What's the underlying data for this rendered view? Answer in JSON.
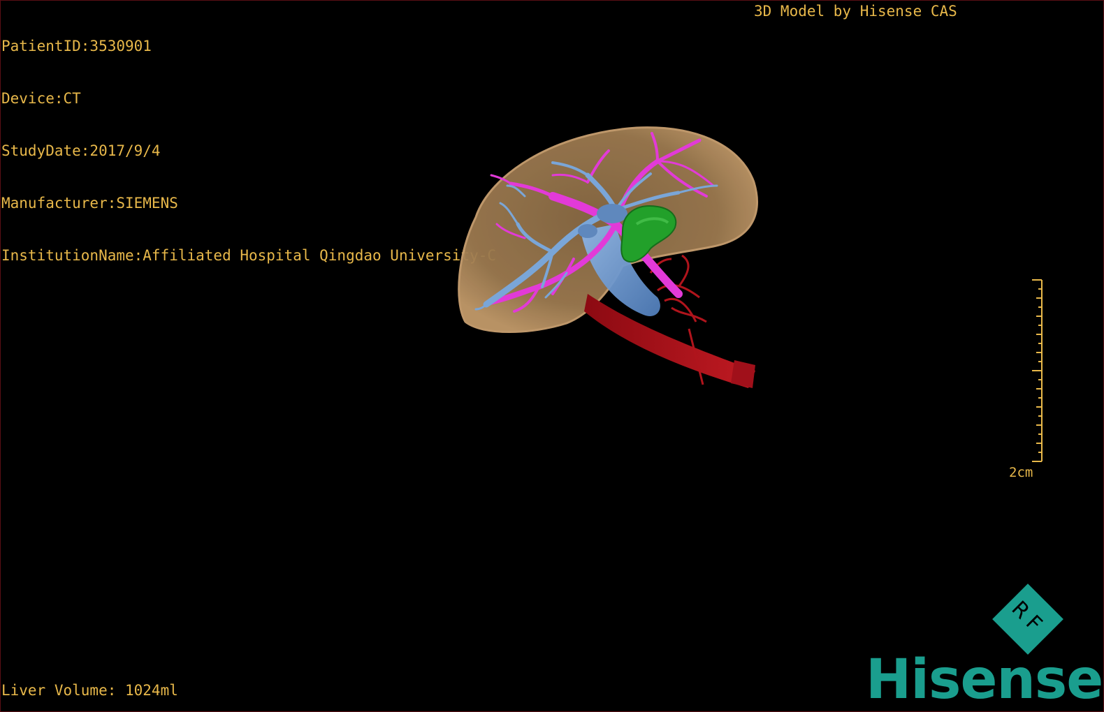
{
  "study": {
    "patient_id": "PatientID:3530901",
    "device": "Device:CT",
    "study_date": "StudyDate:2017/9/4",
    "manufacturer": "Manufacturer:SIEMENS",
    "institution": "InstitutionName:Affiliated Hospital Qingdao University-C"
  },
  "credit": "3D Model by Hisense CAS",
  "scale": {
    "label": "2cm"
  },
  "measurement": {
    "liver_volume": "Liver Volume: 1024ml"
  },
  "branding": {
    "badge_text": "RF",
    "logo_text": "Hisense",
    "logo_color": "#1a9e8e"
  },
  "colors": {
    "overlay_text": "#e8b84a",
    "liver": "#a8845a",
    "portal_vein": "#e23ad8",
    "hepatic_vein": "#7aa6d8",
    "gallbladder": "#22a02a",
    "artery": "#b0141c",
    "background": "#000000"
  },
  "icons": {
    "badge": "rf-diamond-icon"
  }
}
